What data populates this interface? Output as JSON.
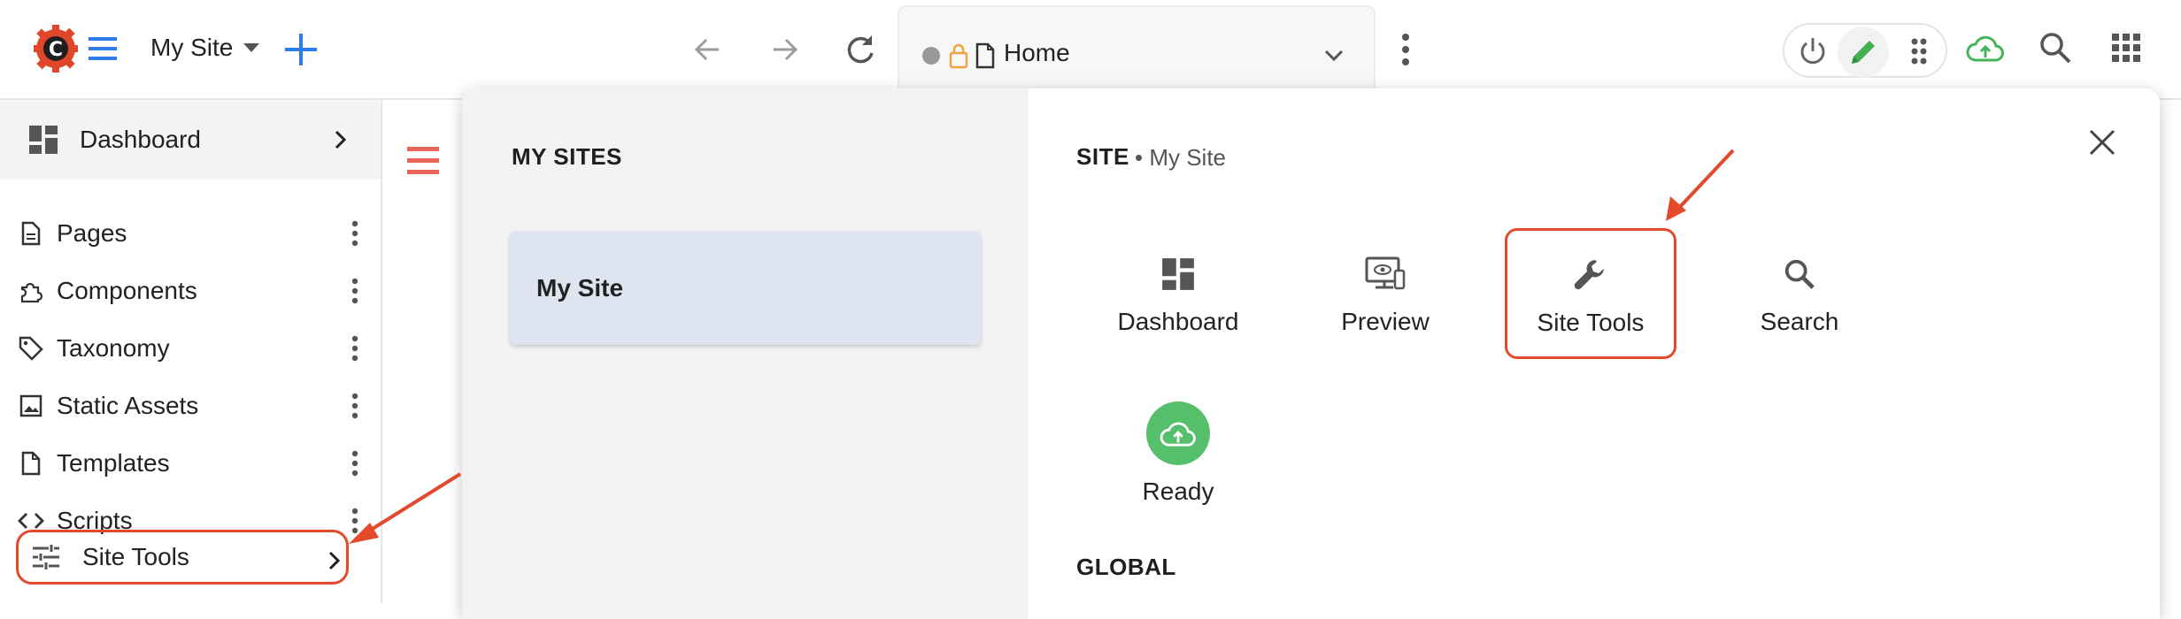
{
  "topbar": {
    "site_name": "My Site",
    "address": "Home",
    "icons": [
      "crafter-logo",
      "menu-icon",
      "plus-icon",
      "back-icon",
      "forward-icon",
      "reload-icon",
      "lock-icon",
      "page-icon",
      "chevron-down-icon",
      "kebab-icon",
      "power-icon",
      "pencil-icon",
      "drag-icon",
      "cloud-upload-icon",
      "search-icon",
      "apps-icon"
    ],
    "accent": "#2f7be8"
  },
  "sidebar": {
    "dashboard_label": "Dashboard",
    "items": [
      {
        "label": "Pages",
        "icon": "page-icon"
      },
      {
        "label": "Components",
        "icon": "puzzle-icon"
      },
      {
        "label": "Taxonomy",
        "icon": "tag-icon"
      },
      {
        "label": "Static Assets",
        "icon": "image-icon"
      },
      {
        "label": "Templates",
        "icon": "page-icon"
      },
      {
        "label": "Scripts",
        "icon": "code-icon"
      }
    ],
    "site_tools_label": "Site Tools"
  },
  "popover": {
    "my_sites_title": "MY SITES",
    "sites": [
      {
        "name": "My Site"
      }
    ],
    "site_section_title": "SITE",
    "site_section_sub": "• My Site",
    "tiles": [
      {
        "label": "Dashboard",
        "icon": "dashboard-icon"
      },
      {
        "label": "Preview",
        "icon": "preview-icon"
      },
      {
        "label": "Site Tools",
        "icon": "wrench-icon"
      },
      {
        "label": "Search",
        "icon": "search-icon"
      },
      {
        "label": "Ready",
        "icon": "cloud-upload-icon"
      }
    ],
    "global_title": "GLOBAL"
  },
  "colors": {
    "highlight": "#e24a2b",
    "ready": "#56bf6b",
    "logo_red": "#e0462a"
  }
}
